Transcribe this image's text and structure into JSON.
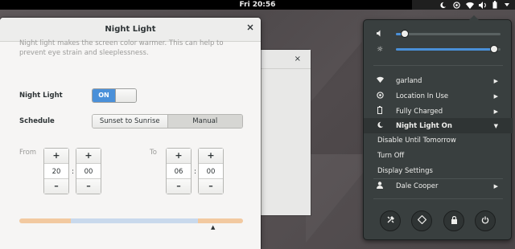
{
  "topbar": {
    "clock": "Fri 20:56",
    "indicators": [
      "night-light-icon",
      "location-icon",
      "wifi-icon",
      "volume-icon",
      "battery-icon",
      "power-menu-icon"
    ]
  },
  "dialog": {
    "title": "Night Light",
    "description": "Night light makes the screen color warmer. This can help to prevent eye strain and sleeplessness.",
    "night_light_label": "Night Light",
    "switch_label": "ON",
    "schedule_label": "Schedule",
    "schedule_options": [
      "Sunset to Sunrise",
      "Manual"
    ],
    "schedule_active": "Manual",
    "from_label": "From",
    "to_label": "To",
    "from_hour": "20",
    "from_minute": "00",
    "to_hour": "06",
    "to_minute": "00",
    "plus": "+",
    "minus": "–",
    "colon": ":"
  },
  "bgwindow": {
    "close_glyph": "×"
  },
  "menu": {
    "volume_level": 0.08,
    "brightness_level": 0.96,
    "wifi": "garland",
    "location": "Location In Use",
    "battery": "Fully Charged",
    "night_light": "Night Light On",
    "night_light_items": [
      "Disable Until Tomorrow",
      "Turn Off",
      "Display Settings"
    ],
    "user": "Dale Cooper",
    "actions": [
      "settings-icon",
      "rotation-lock-icon",
      "lock-icon",
      "power-off-icon"
    ]
  },
  "colors": {
    "accent": "#4a90d9",
    "menu_bg": "#393f3f",
    "warm": "#f2c9a0",
    "cool": "#c9d9ec"
  }
}
